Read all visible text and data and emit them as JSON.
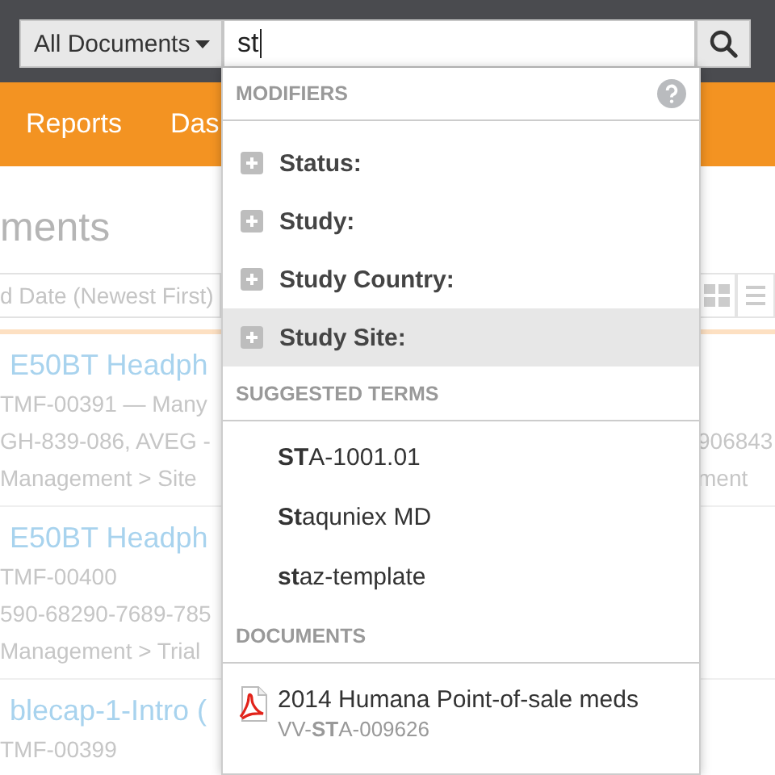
{
  "top_bar": {
    "scope_button": "All Documents",
    "search": {
      "value": "st"
    }
  },
  "nav": {
    "items": [
      {
        "label": "Reports"
      },
      {
        "label": "Das"
      }
    ]
  },
  "page": {
    "title": "ments",
    "sort": "d Date (Newest First)",
    "view_modes": [
      {
        "kind": "grid",
        "selected": false
      },
      {
        "kind": "list",
        "selected": false
      }
    ],
    "results": [
      {
        "title": "E50BT Headph",
        "line_2": "TMF-00391 — Many",
        "line_3": "GH-839-086, AVEG -",
        "line_3_end": "906843",
        "line_4": "Management > Site",
        "line_4_end": "ment"
      },
      {
        "title": "E50BT Headph",
        "line_2": "TMF-00400",
        "line_3": "590-68290-7689-785",
        "line_4": "Management > Trial"
      },
      {
        "title": "blecap-1-Intro (",
        "line_2": "TMF-00399"
      }
    ]
  },
  "dropdown": {
    "modifiers": {
      "heading": "MODIFIERS",
      "items": [
        {
          "label": "Status:",
          "selected": false
        },
        {
          "label": "Study:",
          "selected": false
        },
        {
          "label": "Study Country:",
          "selected": false
        },
        {
          "label": "Study Site:",
          "selected": true
        }
      ]
    },
    "suggested_terms": {
      "heading": "SUGGESTED TERMS",
      "items": [
        "**ST**A-1001.01",
        "**St**aquniex MD",
        "**st**az-template"
      ]
    },
    "documents": {
      "heading": "DOCUMENTS",
      "items": [
        {
          "title": "2014 Humana Point-of-sale meds",
          "number": "VV-**ST**A-009626"
        }
      ]
    }
  }
}
